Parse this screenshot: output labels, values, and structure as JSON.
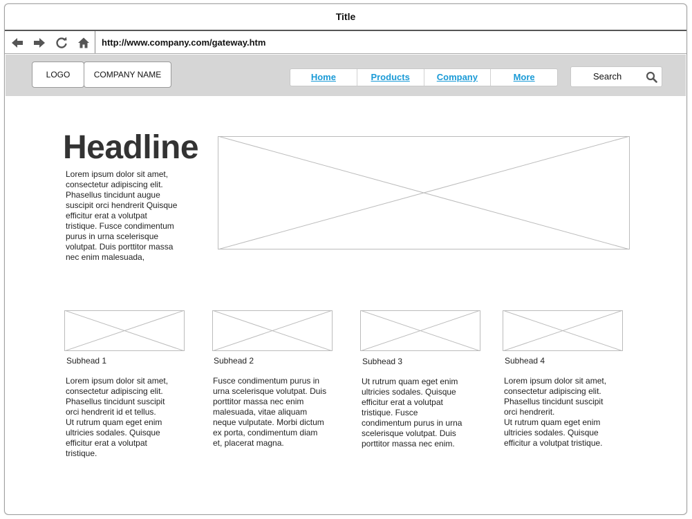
{
  "window": {
    "title": "Title"
  },
  "address_bar": {
    "url": "http://www.company.com/gateway.htm",
    "buttons": [
      "back-arrow-icon",
      "forward-arrow-icon",
      "refresh-icon",
      "home-icon"
    ]
  },
  "header": {
    "logo": "LOGO",
    "company_name": "COMPANY NAME",
    "menu": [
      {
        "label": "Home"
      },
      {
        "label": "Products"
      },
      {
        "label": "Company"
      },
      {
        "label": "More"
      }
    ],
    "search": {
      "placeholder": "Search",
      "icon": "search-icon"
    }
  },
  "hero": {
    "headline": "Headline",
    "text": "Lorem ipsum dolor sit amet,\nconsectetur adipiscing elit.\nPhasellus tincidunt augue\nsuscipit orci hendrerit Quisque\nefficitur erat a volutpat\ntristique. Fusce condimentum\npurus in urna scelerisque\nvolutpat. Duis porttitor massa\nnec enim malesuada,"
  },
  "features": [
    {
      "subhead": "Subhead 1",
      "text": "Lorem ipsum dolor sit amet,\nconsectetur adipiscing elit.\nPhasellus tincidunt suscipit\norci hendrerit id et tellus.\nUt rutrum quam eget enim\nultricies sodales. Quisque\nefficitur erat a volutpat\ntristique."
    },
    {
      "subhead": "Subhead 2",
      "text": " Fusce condimentum purus in\nurna scelerisque volutpat. Duis\nporttitor massa nec enim\nmalesuada, vitae aliquam\nneque vulputate. Morbi dictum\nex porta, condimentum diam\net, placerat magna."
    },
    {
      "subhead": "Subhead 3",
      "text": "Ut rutrum quam eget enim\nultricies sodales. Quisque\nefficitur erat a volutpat\ntristique. Fusce\ncondimentum purus in urna\nscelerisque volutpat. Duis\nporttitor massa nec enim."
    },
    {
      "subhead": "Subhead 4",
      "text": "Lorem ipsum dolor sit amet,\nconsectetur adipiscing elit.\nPhasellus tincidunt suscipit\norci hendrerit.\nUt rutrum quam eget enim\nultricies sodales. Quisque\nefficitur a volutpat tristique."
    }
  ],
  "colors": {
    "link": "#1a9ad6",
    "header_bg": "#d6d6d6",
    "headline": "#333333"
  }
}
